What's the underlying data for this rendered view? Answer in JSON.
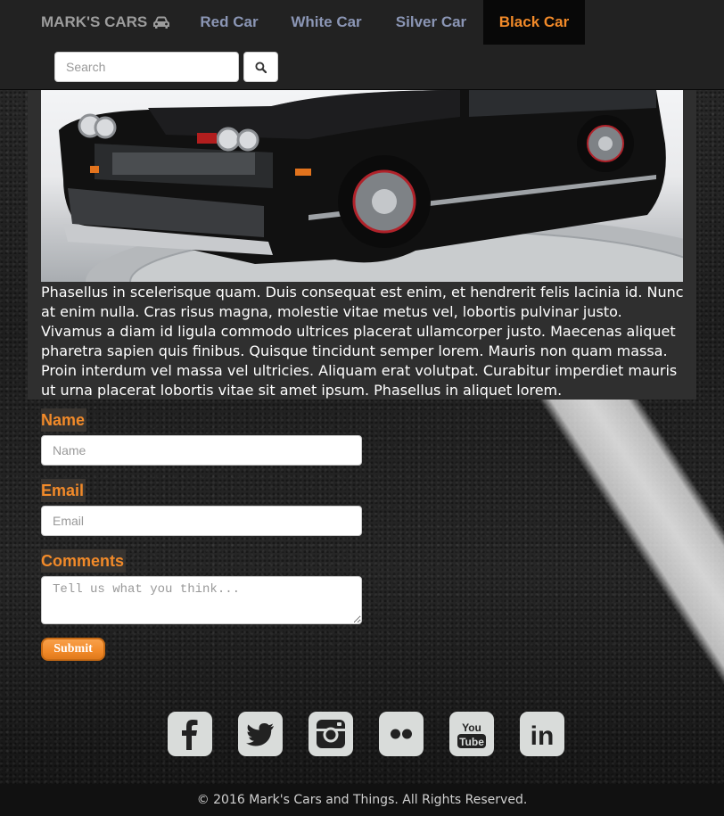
{
  "navbar": {
    "brand": "MARK'S CARS",
    "brand_icon": "car-icon",
    "links": [
      {
        "label": "Red Car"
      },
      {
        "label": "White Car"
      },
      {
        "label": "Silver Car"
      },
      {
        "label": "Black Car",
        "active": true
      }
    ],
    "search": {
      "placeholder": "Search",
      "value": "",
      "button_icon": "search-icon"
    }
  },
  "colors": {
    "accent": "#f28a29",
    "nav_bg": "#222222",
    "nav_link": "#8b96b5",
    "panel_bg": "#2f2f2f"
  },
  "main": {
    "paragraph": "Phasellus in scelerisque quam. Duis consequat est enim, et hendrerit felis lacinia id. Nunc at enim nulla. Cras risus magna, molestie vitae metus vel, lobortis pulvinar justo. Vivamus a diam id ligula commodo ultrices placerat ullamcorper justo. Maecenas aliquet pharetra sapien quis finibus. Quisque tincidunt semper lorem. Mauris non quam massa. Proin interdum vel massa vel ultricies. Aliquam erat volutpat. Curabitur imperdiet mauris ut urna placerat lobortis vitae sit amet ipsum. Phasellus in aliquet lorem."
  },
  "form": {
    "name_label": "Name",
    "name_placeholder": "Name",
    "email_label": "Email",
    "email_placeholder": "Email",
    "comments_label": "Comments",
    "comments_placeholder": "Tell us what you think...",
    "submit_label": "Submit"
  },
  "social": [
    {
      "icon": "facebook-icon"
    },
    {
      "icon": "twitter-icon"
    },
    {
      "icon": "instagram-icon"
    },
    {
      "icon": "flickr-icon"
    },
    {
      "icon": "youtube-icon",
      "text_top": "You",
      "text_bottom": "Tube"
    },
    {
      "icon": "linkedin-icon",
      "text": "in"
    }
  ],
  "footer": {
    "text": "© 2016 Mark's Cars and Things. All Rights Reserved."
  }
}
